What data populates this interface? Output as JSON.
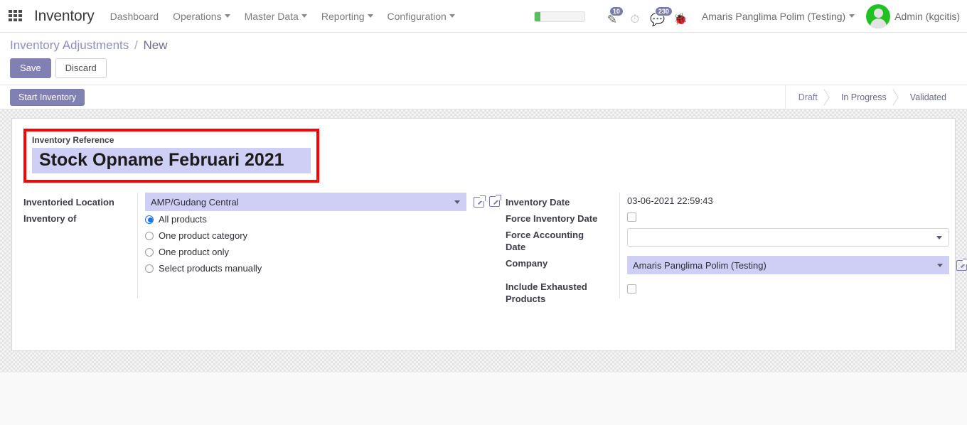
{
  "navbar": {
    "apps_icon": "apps-grid-icon",
    "brand": "Inventory",
    "menu": [
      {
        "label": "Dashboard",
        "has_caret": false
      },
      {
        "label": "Operations",
        "has_caret": true
      },
      {
        "label": "Master Data",
        "has_caret": true
      },
      {
        "label": "Reporting",
        "has_caret": true
      },
      {
        "label": "Configuration",
        "has_caret": true
      }
    ],
    "progress_percent": 12,
    "systray": [
      {
        "icon": "note-edit-icon",
        "glyph": "✎",
        "badge": "10"
      },
      {
        "icon": "clock-icon",
        "glyph": "◴",
        "badge": ""
      },
      {
        "icon": "chat-bubble-icon",
        "glyph": "💬",
        "badge": "230"
      },
      {
        "icon": "bug-debug-icon",
        "glyph": "🐞",
        "badge": ""
      }
    ],
    "company_selector": "Amaris Panglima Polim (Testing)",
    "user_name": "Admin (kgcitis)"
  },
  "control_panel": {
    "breadcrumb_root": "Inventory Adjustments",
    "breadcrumb_sep": "/",
    "breadcrumb_current": "New",
    "save_label": "Save",
    "discard_label": "Discard"
  },
  "statusbar": {
    "start_inventory_label": "Start Inventory",
    "stages": [
      {
        "label": "Draft",
        "active": true
      },
      {
        "label": "In Progress",
        "active": false
      },
      {
        "label": "Validated",
        "active": false
      }
    ]
  },
  "form": {
    "reference": {
      "label": "Inventory Reference",
      "value": "Stock Opname Februari 2021",
      "highlight_color": "#ff0000"
    },
    "left": {
      "location_label": "Inventoried Location",
      "location_value": "AMP/Gudang Central",
      "inventory_of_label": "Inventory of",
      "options": [
        {
          "label": "All products",
          "selected": true
        },
        {
          "label": "One product category",
          "selected": false
        },
        {
          "label": "One product only",
          "selected": false
        },
        {
          "label": "Select products manually",
          "selected": false
        }
      ]
    },
    "right": {
      "inventory_date_label": "Inventory Date",
      "inventory_date_value": "03-06-2021 22:59:43",
      "force_inventory_date_label": "Force Inventory Date",
      "force_inventory_date_checked": false,
      "force_accounting_date_label": "Force Accounting Date",
      "force_accounting_date_value": "",
      "company_label": "Company",
      "company_value": "Amaris Panglima Polim (Testing)",
      "include_exhausted_label": "Include Exhausted Products",
      "include_exhausted_checked": false
    }
  }
}
